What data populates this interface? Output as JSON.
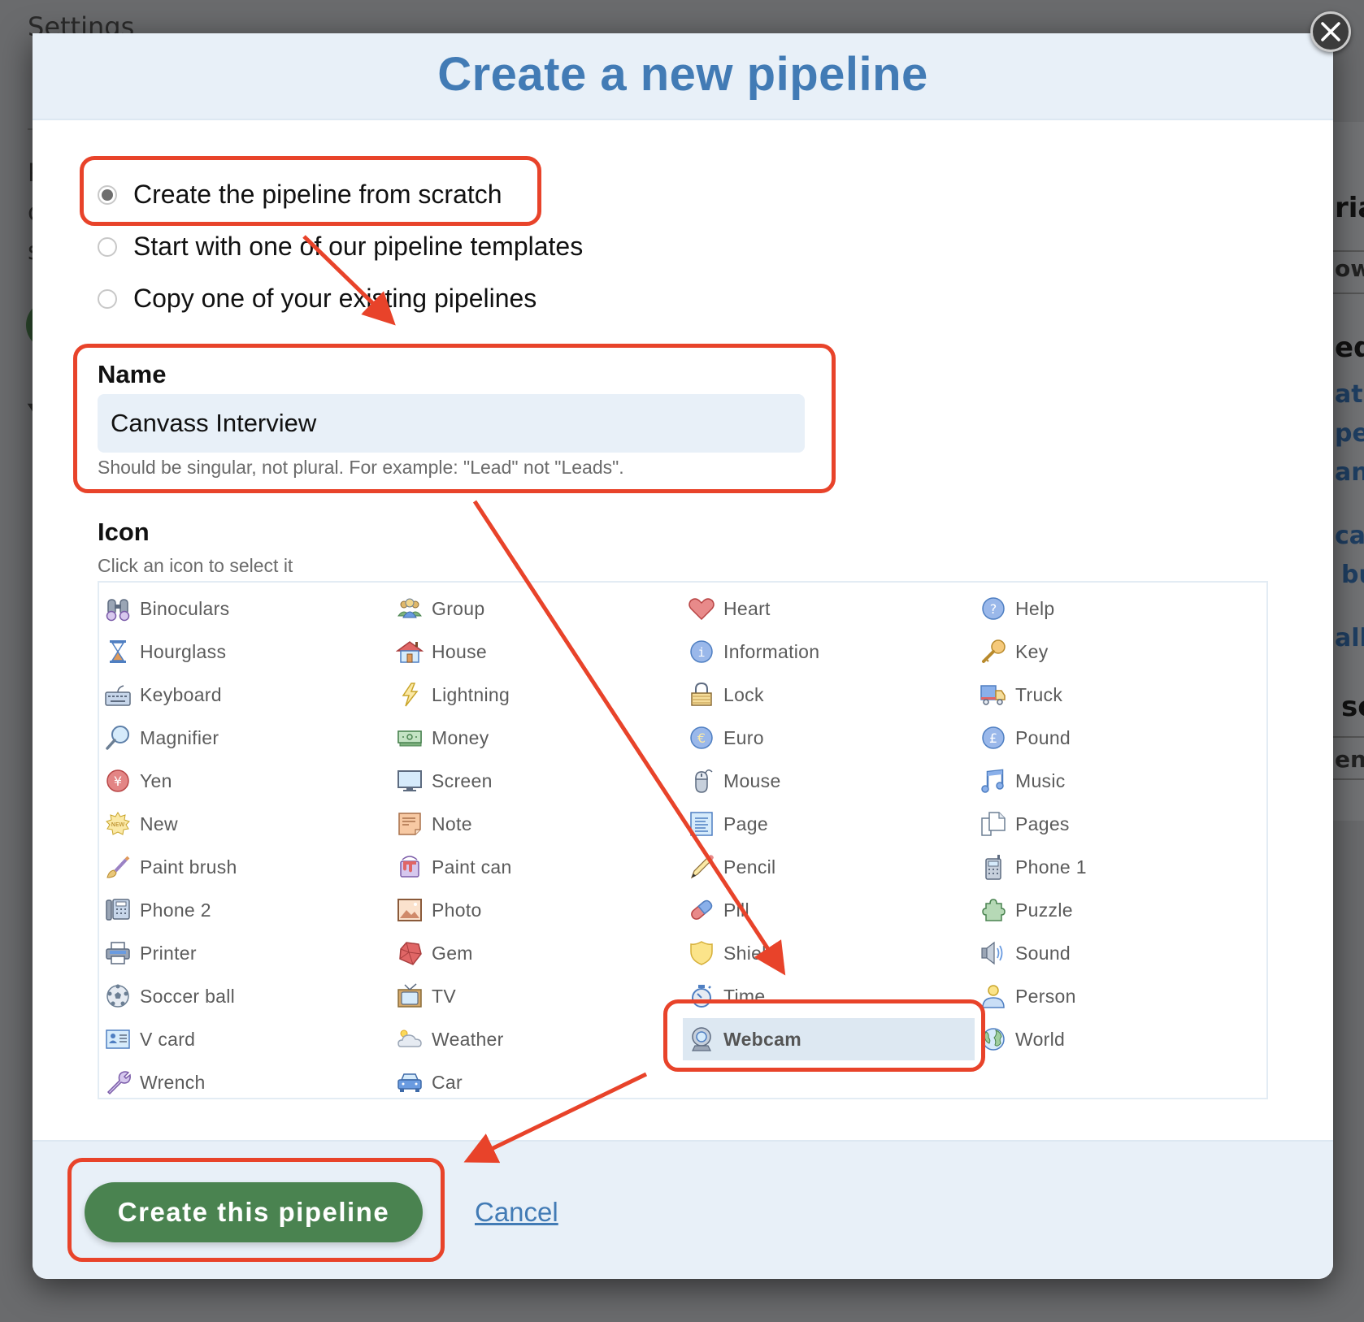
{
  "background": {
    "page_heading": "Settings",
    "left_fragments": [
      "P",
      "c",
      "s",
      "Y"
    ],
    "right_fragments": [
      {
        "text": "rial",
        "kind": "heading"
      },
      {
        "text": "ow",
        "kind": "text"
      },
      {
        "text": "ed",
        "kind": "heading"
      },
      {
        "text": "at s",
        "kind": "link"
      },
      {
        "text": "pel",
        "kind": "link"
      },
      {
        "text": "ani",
        "kind": "link"
      },
      {
        "text": "can",
        "kind": "link"
      },
      {
        "text": "bu",
        "kind": "link"
      },
      {
        "text": "all",
        "kind": "link"
      },
      {
        "text": "so",
        "kind": "heading"
      },
      {
        "text": "en",
        "kind": "text"
      }
    ]
  },
  "modal": {
    "title": "Create a new pipeline",
    "close_icon": "close-icon",
    "creation_options": [
      {
        "label": "Create the pipeline from scratch",
        "checked": true
      },
      {
        "label": "Start with one of our pipeline templates",
        "checked": false
      },
      {
        "label": "Copy one of your existing pipelines",
        "checked": false
      }
    ],
    "name_field": {
      "label": "Name",
      "value": "Canvass Interview",
      "hint": "Should be singular, not plural. For example: \"Lead\" not \"Leads\"."
    },
    "icon_field": {
      "label": "Icon",
      "subtext": "Click an icon to select it",
      "selected": "Webcam",
      "columns": [
        [
          "Binoculars",
          "Hourglass",
          "Keyboard",
          "Magnifier",
          "Yen",
          "New",
          "Paint brush",
          "Phone 2",
          "Printer",
          "Soccer ball",
          "V card",
          "Wrench"
        ],
        [
          "Group",
          "House",
          "Lightning",
          "Money",
          "Screen",
          "Note",
          "Paint can",
          "Photo",
          "Gem",
          "TV",
          "Weather",
          "Car"
        ],
        [
          "Heart",
          "Information",
          "Lock",
          "Euro",
          "Mouse",
          "Page",
          "Pencil",
          "Pill",
          "Shield",
          "Time",
          "Webcam"
        ],
        [
          "Help",
          "Key",
          "Truck",
          "Pound",
          "Music",
          "Pages",
          "Phone 1",
          "Puzzle",
          "Sound",
          "Person",
          "World"
        ]
      ]
    },
    "footer": {
      "create_label": "Create this pipeline",
      "cancel_label": "Cancel"
    }
  },
  "colors": {
    "title_blue": "#427bb5",
    "primary_green": "#4a8350",
    "annotation_red": "#e8432a",
    "header_bg": "#e8f0f8",
    "selected_bg": "#dde8f2"
  }
}
